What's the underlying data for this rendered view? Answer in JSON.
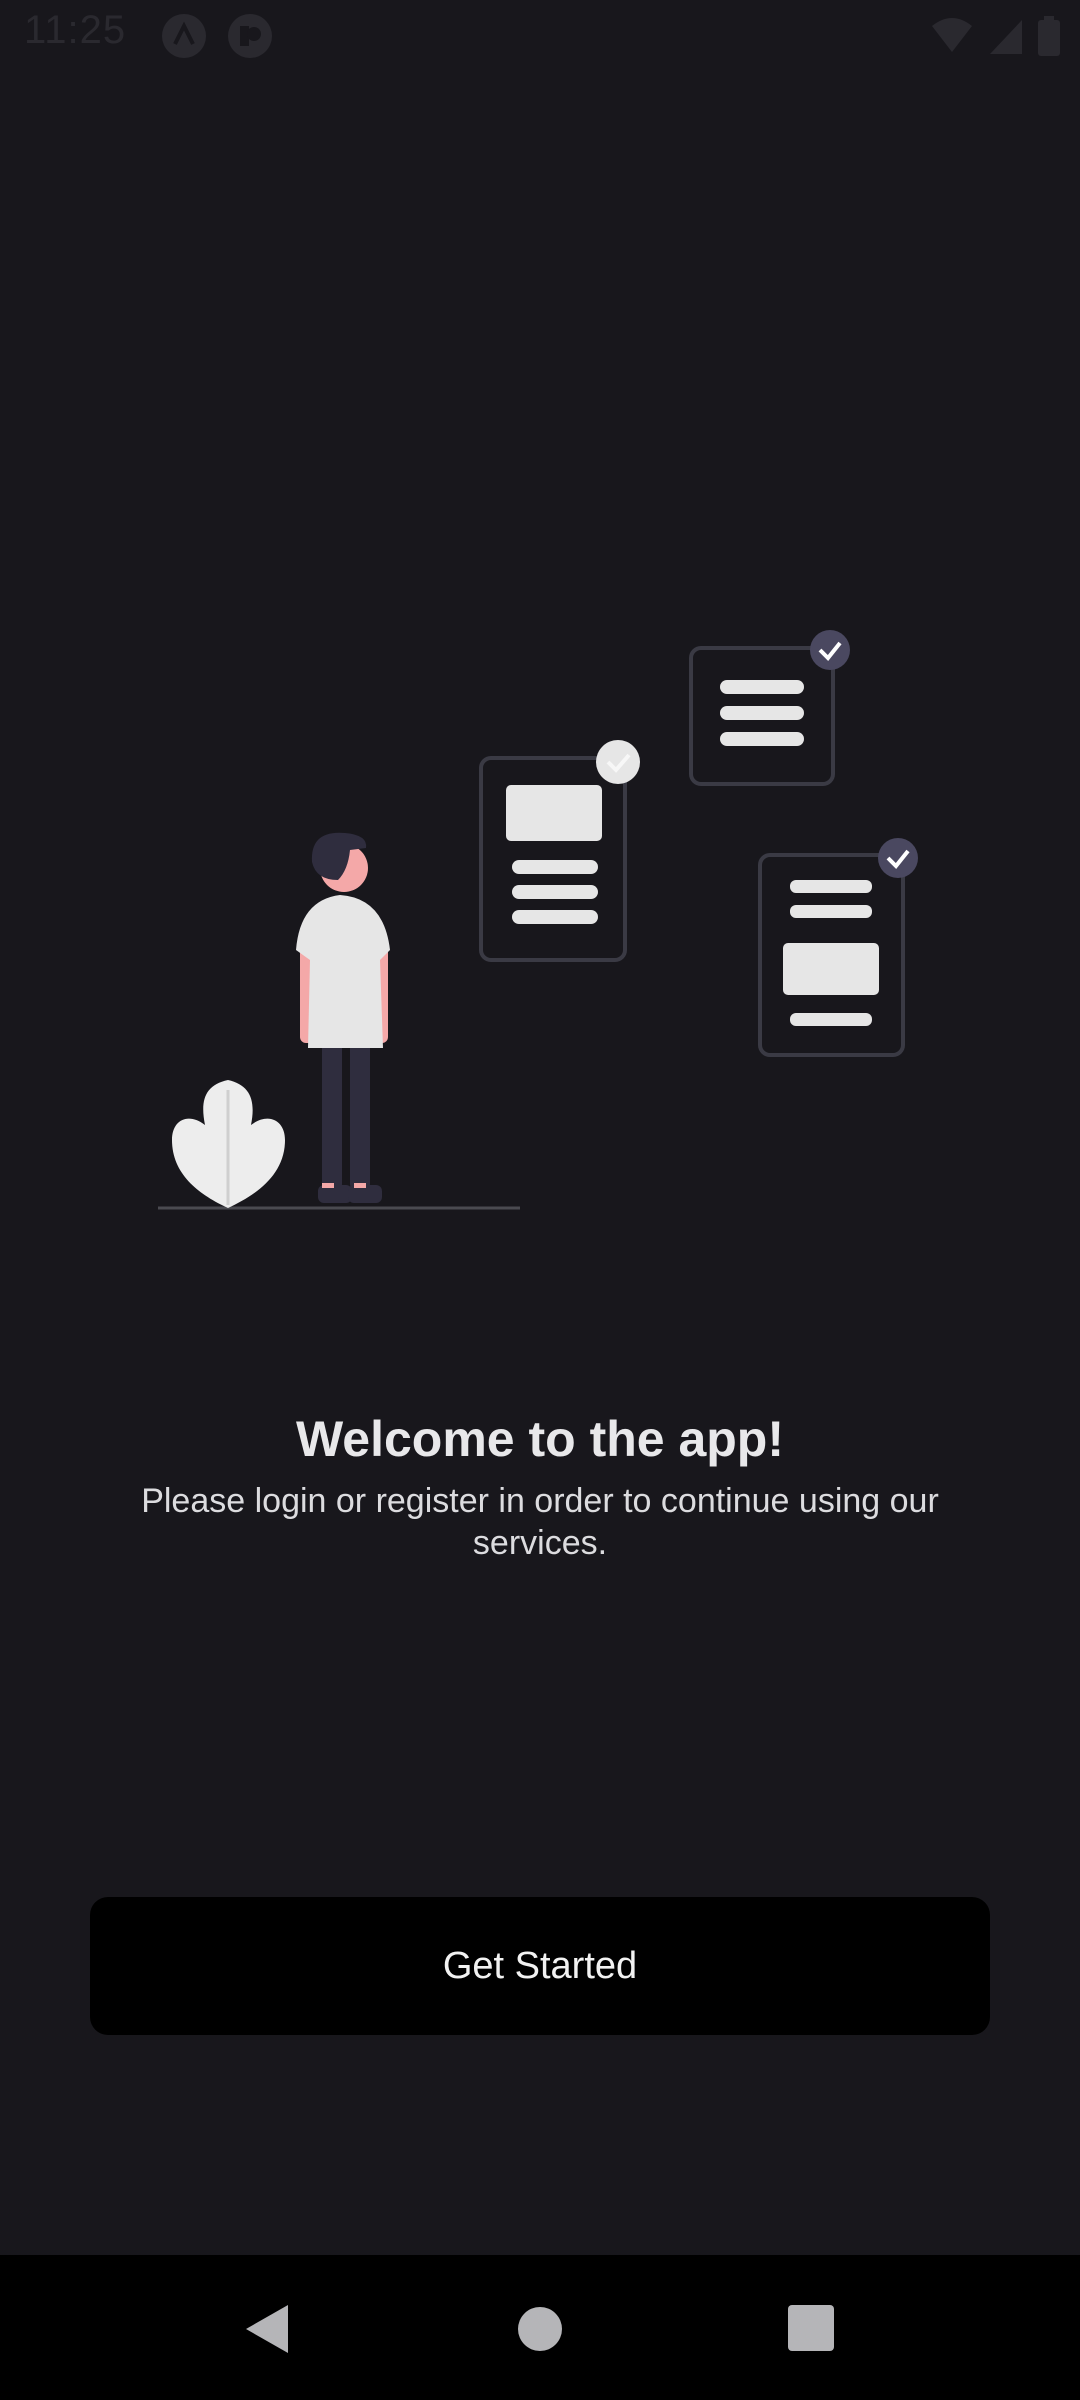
{
  "status_bar": {
    "time": "11:25",
    "icons": [
      "app-a-icon",
      "app-b-icon",
      "wifi-icon",
      "signal-icon",
      "battery-icon"
    ]
  },
  "illustration": {
    "description_icon": "person-with-checklists-illustration"
  },
  "welcome": {
    "title": "Welcome to the app!",
    "subtitle": "Please login or register in order to continue using our services."
  },
  "actions": {
    "get_started_label": "Get Started"
  },
  "nav_bar": {
    "icons": [
      "back-icon",
      "home-icon",
      "recents-icon"
    ]
  },
  "colors": {
    "background": "#18171c",
    "button": "#000000",
    "accent_check": "#4a4860"
  }
}
